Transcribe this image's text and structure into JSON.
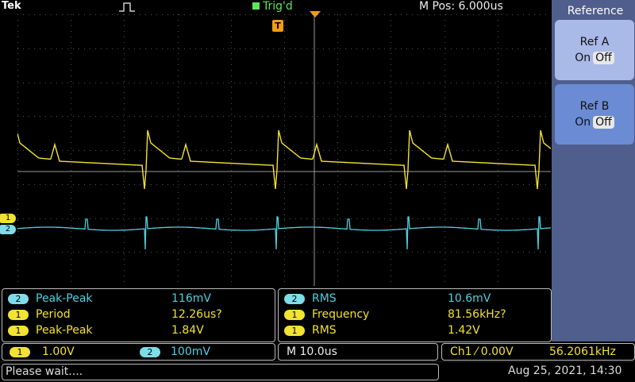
{
  "header": {
    "brand": "Tek",
    "trigger_status": "Trig'd",
    "m_pos": "M Pos: 6.000us"
  },
  "side_menu": {
    "title": "Reference",
    "ref_a": {
      "label": "Ref A",
      "on": "On",
      "off": "Off"
    },
    "ref_b": {
      "label": "Ref B",
      "on": "On",
      "off": "Off"
    }
  },
  "channel_markers": {
    "ch1": "1",
    "ch2": "2"
  },
  "trigger_marker": "T",
  "measurements_left": [
    {
      "ch": "2",
      "name": "Peak-Peak",
      "value": "116mV"
    },
    {
      "ch": "1",
      "name": "Period",
      "value": "12.26us?"
    },
    {
      "ch": "1",
      "name": "Peak-Peak",
      "value": "1.84V"
    }
  ],
  "measurements_right": [
    {
      "ch": "2",
      "name": "RMS",
      "value": "10.6mV"
    },
    {
      "ch": "1",
      "name": "Frequency",
      "value": "81.56kHz?"
    },
    {
      "ch": "1",
      "name": "RMS",
      "value": "1.42V"
    }
  ],
  "scale": {
    "ch1_badge": "1",
    "ch1": "1.00V",
    "ch2_badge": "2",
    "ch2": "100mV",
    "timebase": "M 10.0us",
    "trigger": "Ch1 ⁄ 0.00V",
    "trigger_freq": "56.2061kHz"
  },
  "status": {
    "message": "Please wait....",
    "datetime": "Aug 25, 2021, 14:30"
  },
  "colors": {
    "ch1": "#f2e233",
    "ch2": "#4fd0e0",
    "side_menu": "#4f5e8c",
    "trig": "#5fe35f",
    "marker": "#f39c12"
  }
}
